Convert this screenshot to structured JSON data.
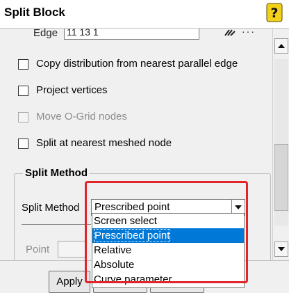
{
  "window": {
    "title": "Split Block"
  },
  "edge": {
    "label": "Edge",
    "value": "11 13 1"
  },
  "options": {
    "copy_distribution": "Copy distribution from nearest parallel edge",
    "project_vertices": "Project vertices",
    "move_ogrid_nodes": "Move O-Grid nodes",
    "split_nearest_meshed": "Split at nearest meshed node"
  },
  "split_method": {
    "group_title": "Split Method",
    "label": "Split Method",
    "selected": "Prescribed point",
    "options": [
      "Screen select",
      "Prescribed point",
      "Relative",
      "Absolute",
      "Curve parameter"
    ]
  },
  "point": {
    "label": "Point"
  },
  "buttons": {
    "apply": "Apply"
  },
  "colors": {
    "highlight": "#e0262b",
    "selection": "#0078d7"
  }
}
